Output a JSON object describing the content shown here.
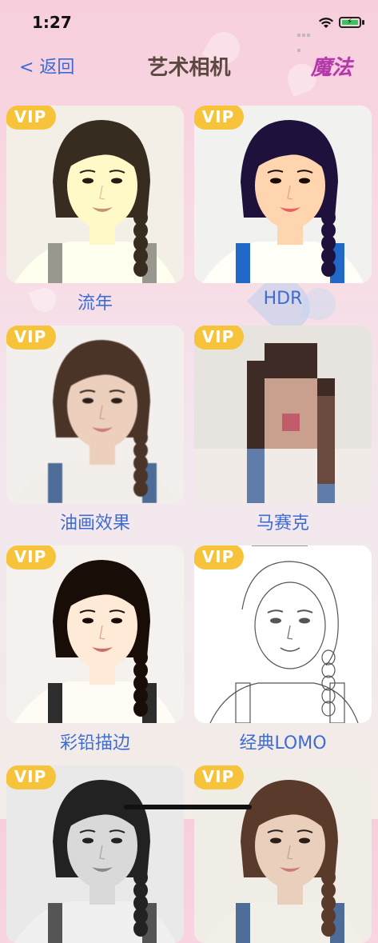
{
  "status_bar": {
    "time": "1:27"
  },
  "nav": {
    "back_label": "< 返回",
    "title": "艺术相机",
    "magic_label": "魔法"
  },
  "badge_label": "VIP",
  "filters": [
    {
      "name": "流年",
      "style": "vintage"
    },
    {
      "name": "HDR",
      "style": "hdr"
    },
    {
      "name": "油画效果",
      "style": "oil"
    },
    {
      "name": "马赛克",
      "style": "mosaic"
    },
    {
      "name": "彩铅描边",
      "style": "pencil-color"
    },
    {
      "name": "经典LOMO",
      "style": "sketch"
    },
    {
      "name": "",
      "style": "partial-bw"
    },
    {
      "name": "",
      "style": "partial-color"
    }
  ]
}
